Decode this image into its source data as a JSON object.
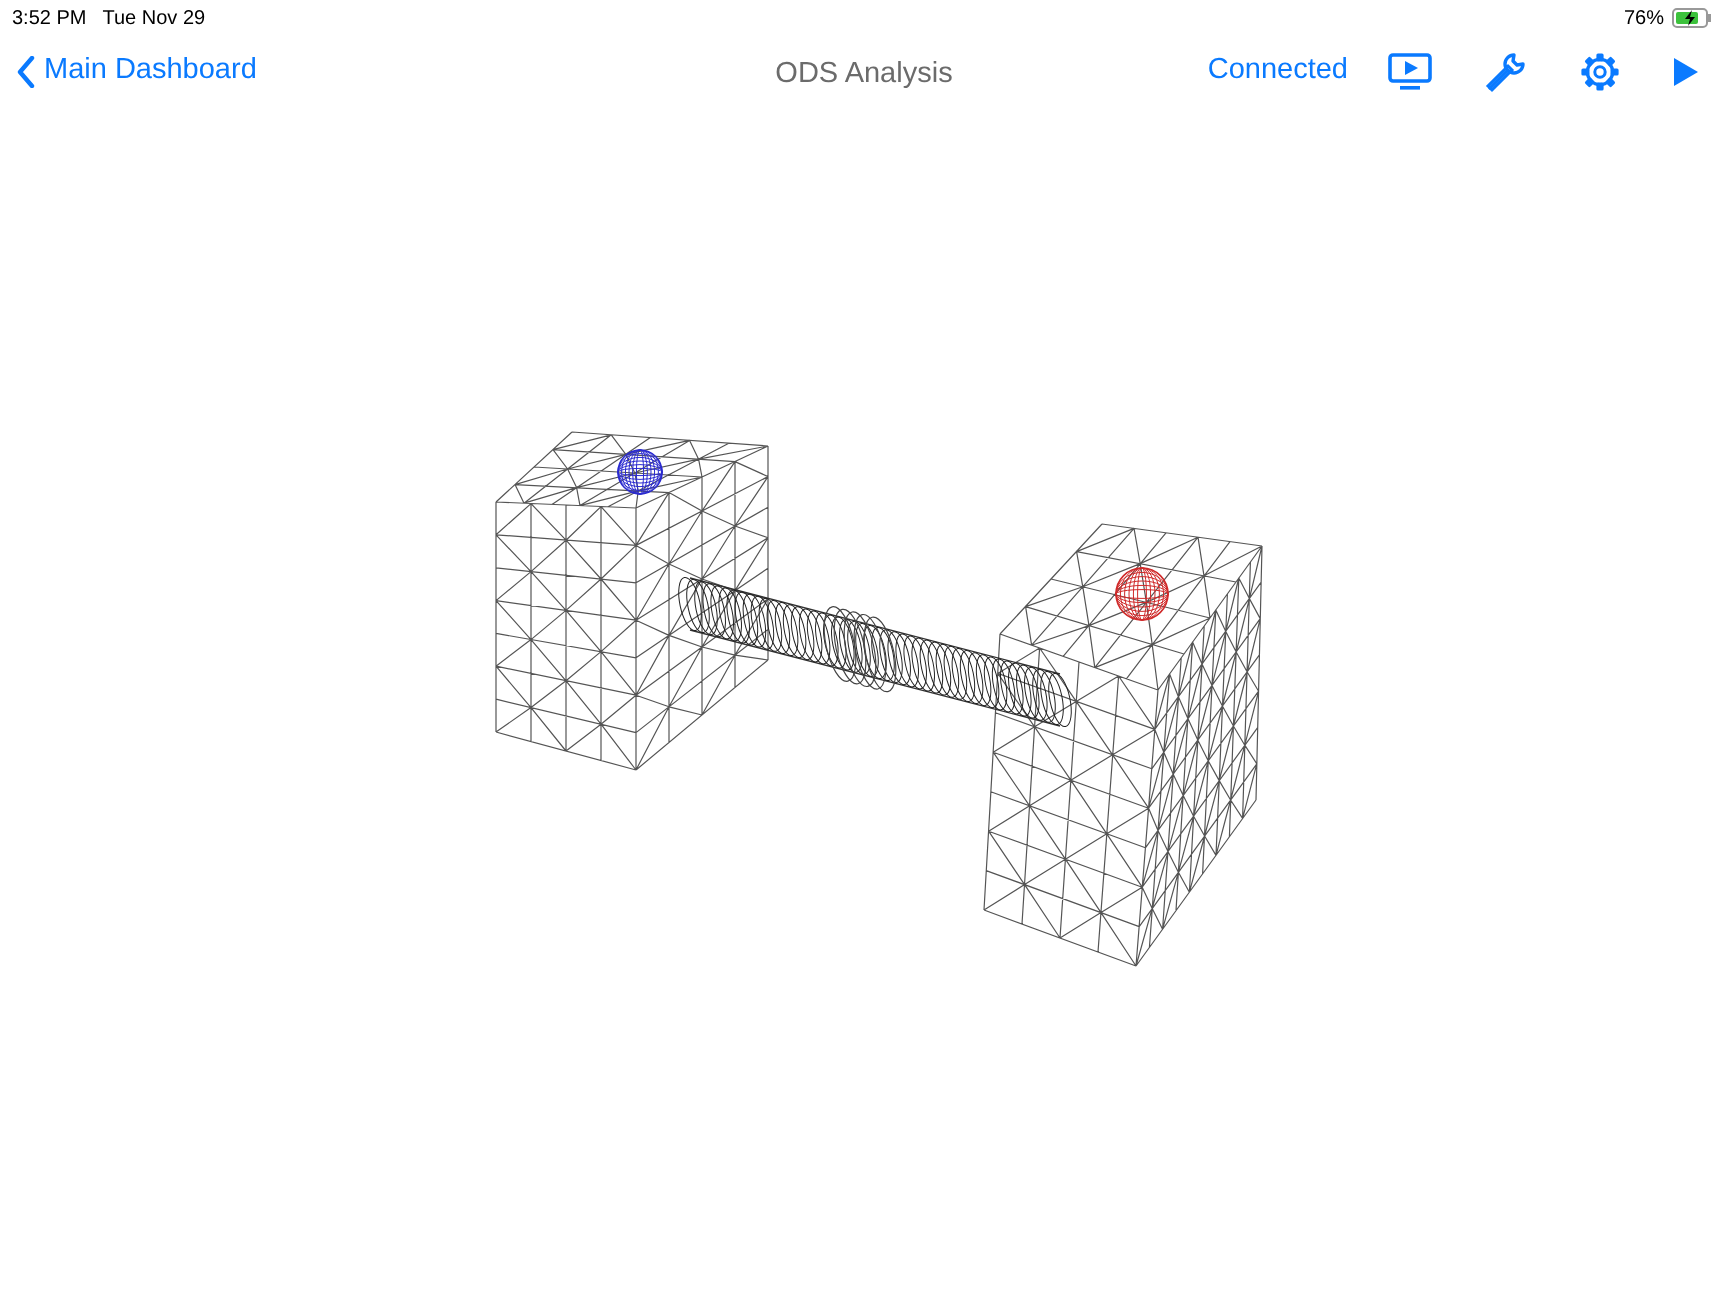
{
  "status_bar": {
    "time": "3:52 PM",
    "date": "Tue Nov 29",
    "battery": "76%"
  },
  "nav_bar": {
    "back": "Main Dashboard",
    "title": "ODS Analysis",
    "connection": "Connected"
  },
  "viewport": {
    "kind": "mesh"
  }
}
